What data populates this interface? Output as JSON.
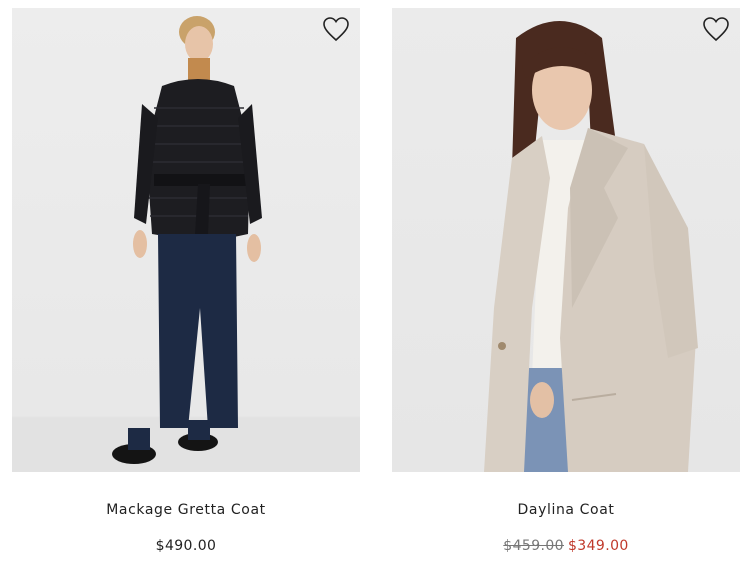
{
  "products": [
    {
      "name": "Mackage Gretta Coat",
      "price": "$490.00",
      "image_description_icon": "model-black-puffer-coat-image",
      "wishlist_icon": "heart-outline-icon"
    },
    {
      "name": "Daylina Coat",
      "original_price": "$459.00",
      "sale_price": "$349.00",
      "image_description_icon": "model-oatmeal-wool-coat-image",
      "wishlist_icon": "heart-outline-icon"
    }
  ],
  "colors": {
    "sale_price": "#c0392b",
    "strike_price": "#777777",
    "text": "#222222"
  }
}
